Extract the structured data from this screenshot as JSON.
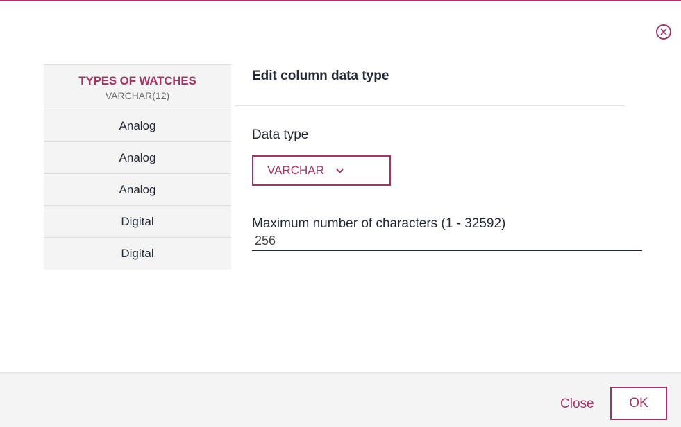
{
  "dialog": {
    "title": "Edit column data type",
    "accent_color": "#a33468",
    "close_icon": "close-circle-icon"
  },
  "preview": {
    "column_name": "TYPES OF WATCHES",
    "column_type": "VARCHAR(12)",
    "rows": [
      "Analog",
      "Analog",
      "Analog",
      "Digital",
      "Digital"
    ]
  },
  "form": {
    "data_type_label": "Data type",
    "data_type_value": "VARCHAR",
    "data_type_icon": "chevron-down-icon",
    "max_chars_label": "Maximum number of characters (1 - 32592)",
    "max_chars_value": "256"
  },
  "footer": {
    "close_label": "Close",
    "ok_label": "OK"
  }
}
